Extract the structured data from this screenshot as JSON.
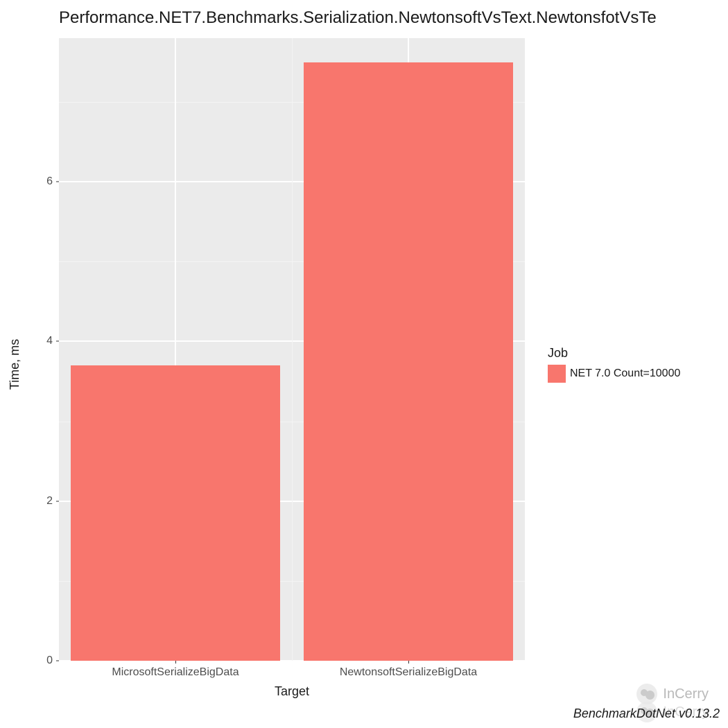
{
  "chart_data": {
    "type": "bar",
    "title": "Performance.NET7.Benchmarks.Serialization.NewtonsoftVsText.NewtonsfotVsTe",
    "xlabel": "Target",
    "ylabel": "Time, ms",
    "categories": [
      "MicrosoftSerializeBigData",
      "NewtonsoftSerializeBigData"
    ],
    "series": [
      {
        "name": "NET 7.0 Count=10000",
        "values": [
          3.7,
          7.5
        ],
        "color": "#f8766d"
      }
    ],
    "y_ticks": [
      0,
      2,
      4,
      6
    ],
    "ylim": [
      0,
      7.8
    ],
    "legend_title": "Job",
    "legend_position": "right",
    "grid": true
  },
  "caption": "BenchmarkDotNet v0.13.2",
  "watermark": {
    "text": "InCerry"
  }
}
